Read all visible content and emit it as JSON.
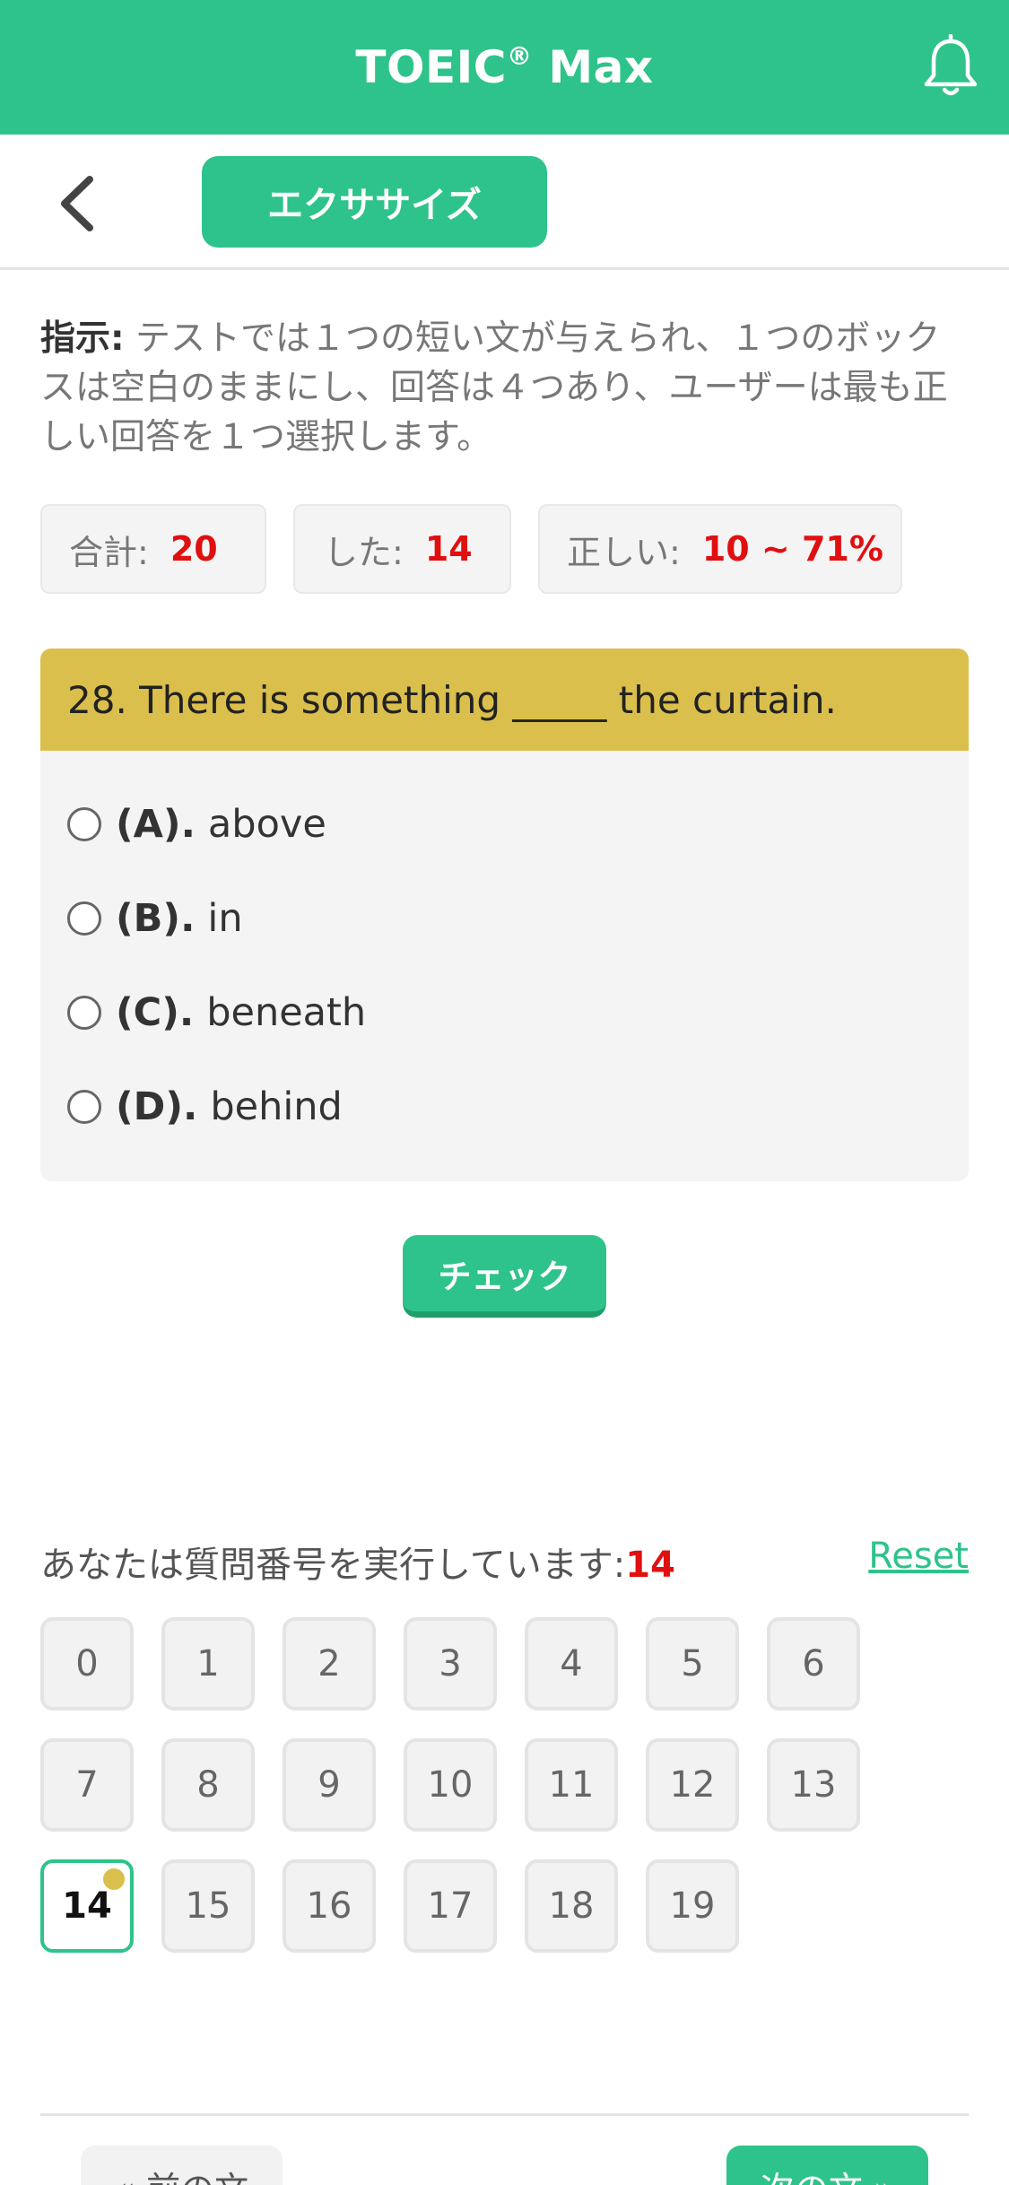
{
  "header": {
    "title": "TOEIC",
    "title_mark": "®",
    "title_suffix": " Max",
    "icon": "bell-icon"
  },
  "subnav": {
    "back_icon": "chevron-left-icon",
    "tab_label": "エクササイズ"
  },
  "instructions": {
    "label": "指示:",
    "text": " テストでは１つの短い文が与えられ、１つのボックスは空白のままにし、回答は４つあり、ユーザーは最も正しい回答を１つ選択します。"
  },
  "stats": {
    "total_label": "合計:",
    "total_value": "20",
    "done_label": "した:",
    "done_value": "14",
    "correct_label": "正しい:",
    "correct_value": "10 ~ 71%"
  },
  "question": {
    "text": "28. There is something _____ the curtain.",
    "options": [
      {
        "letter": "(A).",
        "text": "above"
      },
      {
        "letter": "(B).",
        "text": "in"
      },
      {
        "letter": "(C).",
        "text": "beneath"
      },
      {
        "letter": "(D).",
        "text": "behind"
      }
    ]
  },
  "check_label": "チェック",
  "progress": {
    "label": "あなたは質問番号を実行しています:",
    "current": "14",
    "reset_label": "Reset",
    "numbers": [
      "0",
      "1",
      "2",
      "3",
      "4",
      "5",
      "6",
      "7",
      "8",
      "9",
      "10",
      "11",
      "12",
      "13",
      "14",
      "15",
      "16",
      "17",
      "18",
      "19"
    ]
  },
  "footer": {
    "prev_label": "« 前の文",
    "next_label": "次の文 »"
  },
  "colors": {
    "brand": "#2ec38a",
    "question_header": "#dbbf4c",
    "accent_red": "#e01010"
  }
}
